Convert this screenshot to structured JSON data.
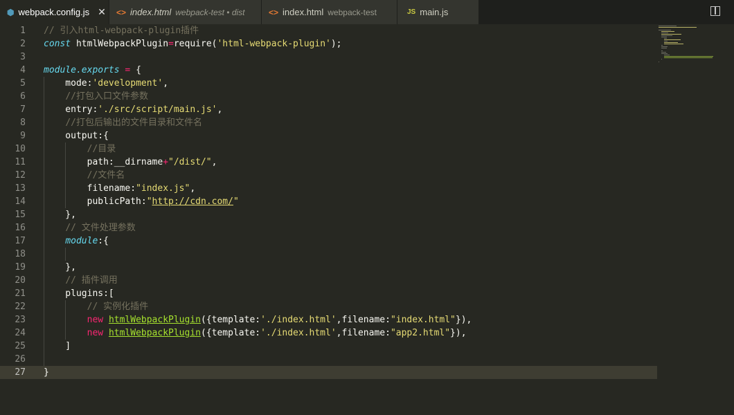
{
  "tabs": [
    {
      "icon": "⬢",
      "icon_name": "webpack-file-icon",
      "title": "webpack.config.js",
      "desc": "",
      "close": "✕",
      "active": true
    },
    {
      "icon": "<>",
      "icon_name": "html-file-icon",
      "title": "index.html",
      "desc": "webpack-test • dist",
      "active": false
    },
    {
      "icon": "<>",
      "icon_name": "html-file-icon",
      "title": "index.html",
      "desc": "webpack-test",
      "active": false
    },
    {
      "icon": "JS",
      "icon_name": "js-file-icon",
      "title": "main.js",
      "desc": "",
      "active": false
    }
  ],
  "editor": {
    "current_line": 27,
    "line_numbers": [
      "1",
      "2",
      "3",
      "4",
      "5",
      "6",
      "7",
      "8",
      "9",
      "10",
      "11",
      "12",
      "13",
      "14",
      "15",
      "16",
      "17",
      "18",
      "19",
      "20",
      "21",
      "22",
      "23",
      "24",
      "25",
      "26",
      "27"
    ],
    "lines": [
      "// 引入html-webpack-plugin插件",
      "const htmlWebpackPlugin=require('html-webpack-plugin');",
      "",
      "module.exports = {",
      "    mode:'development',",
      "    //打包入口文件参数",
      "    entry:'./src/script/main.js',",
      "    //打包后输出的文件目录和文件名",
      "    output:{",
      "        //目录",
      "        path:__dirname+\"/dist/\",",
      "        //文件名",
      "        filename:\"index.js\",",
      "        publicPath:\"http://cdn.com/\"",
      "    },",
      "    // 文件处理参数",
      "    module:{",
      "",
      "    },",
      "    // 插件调用",
      "    plugins:[",
      "        // 实例化插件",
      "        new htmlWebpackPlugin({template:'./index.html',filename:\"index.html\"}),",
      "        new htmlWebpackPlugin({template:'./index.html',filename:\"app2.html\"}),",
      "    ]",
      "",
      "}"
    ]
  },
  "colors": {
    "background": "#272822",
    "comment": "#75715e",
    "keyword": "#66d9ef",
    "operator": "#f92672",
    "string": "#e6db74",
    "function": "#a6e22e"
  }
}
